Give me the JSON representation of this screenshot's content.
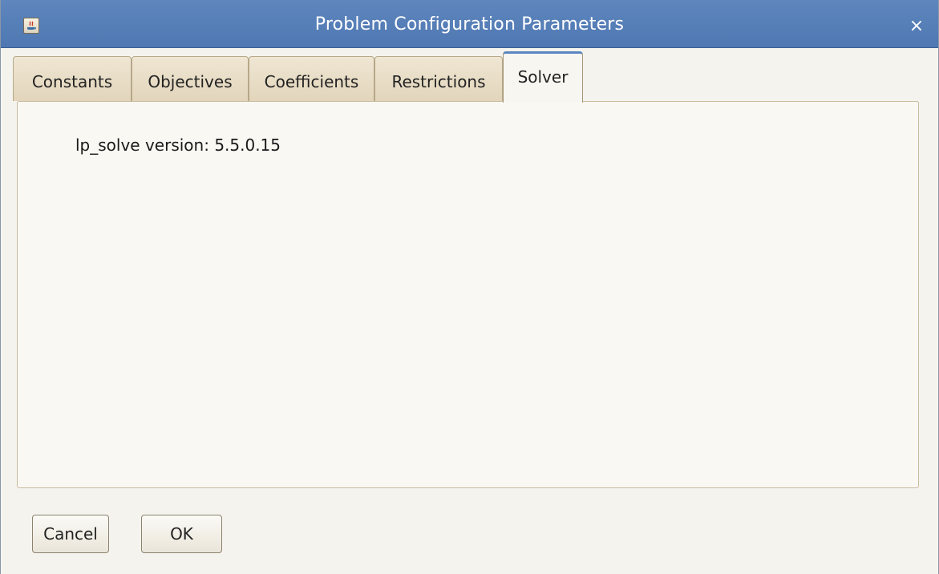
{
  "window": {
    "title": "Problem Configuration Parameters",
    "close_label": "×"
  },
  "tabs": [
    {
      "label": "Constants",
      "active": false
    },
    {
      "label": "Objectives",
      "active": false
    },
    {
      "label": "Coefficients",
      "active": false
    },
    {
      "label": "Restrictions",
      "active": false
    },
    {
      "label": "Solver",
      "active": true
    }
  ],
  "solver_panel": {
    "version_label": "lp_solve version:",
    "version_value": "5.5.0.15"
  },
  "buttons": {
    "cancel_label": "Cancel",
    "ok_label": "OK"
  },
  "colors": {
    "titlebar": "#5a82ba",
    "active_tab_accent": "#5c86c0",
    "inactive_tab": "#e8dcc4",
    "panel_background": "#faf8f3"
  }
}
